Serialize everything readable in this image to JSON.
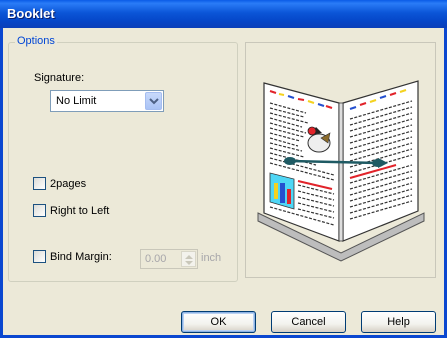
{
  "window": {
    "title": "Booklet"
  },
  "options": {
    "legend": "Options",
    "signature_label": "Signature:",
    "signature_value": "No Limit",
    "two_pages_label": "2pages",
    "two_pages_checked": false,
    "right_to_left_label": "Right to Left",
    "right_to_left_checked": false,
    "bind_margin_label": "Bind Margin:",
    "bind_margin_checked": false,
    "bind_margin_value": "0.00",
    "bind_margin_unit": "inch"
  },
  "preview": {
    "icon": "booklet-preview-illustration"
  },
  "buttons": {
    "ok": "OK",
    "cancel": "Cancel",
    "help": "Help"
  },
  "colors": {
    "title_bar": "#0b56d8",
    "legend": "#0046d5",
    "disabled_text": "#a7a6aa"
  }
}
